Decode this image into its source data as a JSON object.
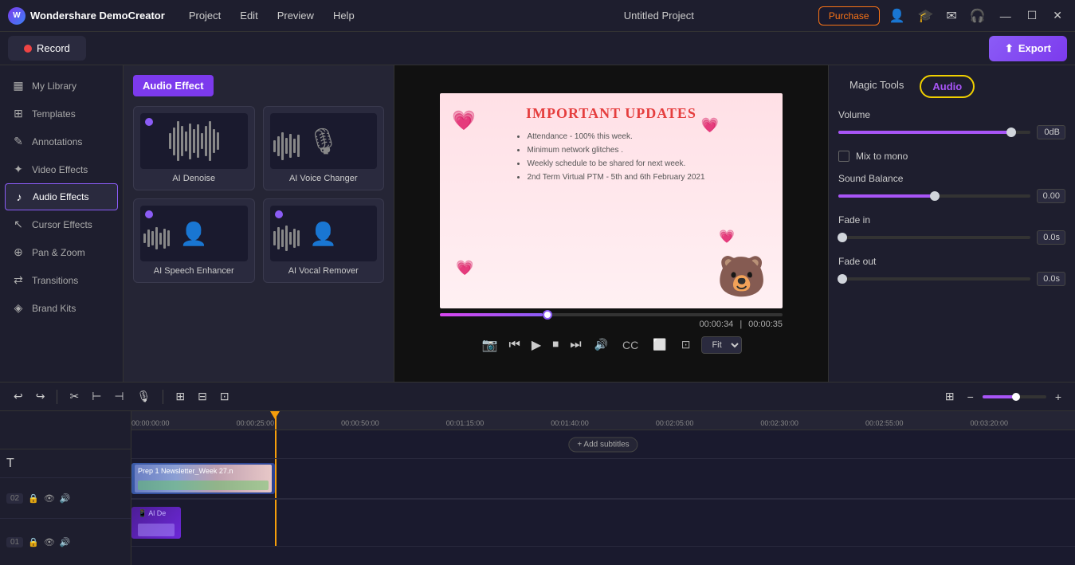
{
  "app": {
    "name": "Wondershare DemoCreator",
    "logo_icon": "W",
    "project_title": "Untitled Project"
  },
  "topbar": {
    "menu": [
      "Project",
      "Edit",
      "Preview",
      "Help"
    ],
    "purchase_label": "Purchase",
    "window_controls": [
      "—",
      "☐",
      "✕"
    ]
  },
  "recordbar": {
    "record_label": "Record",
    "export_label": "Export"
  },
  "sidebar": {
    "items": [
      {
        "id": "my-library",
        "label": "My Library",
        "icon": "▦"
      },
      {
        "id": "templates",
        "label": "Templates",
        "icon": "⊞"
      },
      {
        "id": "annotations",
        "label": "Annotations",
        "icon": "✎"
      },
      {
        "id": "video-effects",
        "label": "Video Effects",
        "icon": "✦"
      },
      {
        "id": "audio-effects",
        "label": "Audio Effects",
        "icon": "♪",
        "active": true
      },
      {
        "id": "cursor-effects",
        "label": "Cursor Effects",
        "icon": "↖"
      },
      {
        "id": "pan-zoom",
        "label": "Pan & Zoom",
        "icon": "⊕"
      },
      {
        "id": "transitions",
        "label": "Transitions",
        "icon": "⇄"
      },
      {
        "id": "brand-kits",
        "label": "Brand Kits",
        "icon": "◈"
      }
    ]
  },
  "audio_effects_panel": {
    "header": "Audio Effect",
    "effects": [
      {
        "id": "ai-denoise",
        "label": "AI Denoise",
        "has_purple_dot": true,
        "icon": "wave"
      },
      {
        "id": "ai-voice-changer",
        "label": "AI Voice Changer",
        "has_purple_dot": false,
        "icon": "mic"
      },
      {
        "id": "ai-speech-enhancer",
        "label": "AI Speech Enhancer",
        "has_purple_dot": true,
        "icon": "person"
      },
      {
        "id": "ai-vocal-remover",
        "label": "AI Vocal Remover",
        "has_purple_dot": true,
        "icon": "person2"
      }
    ]
  },
  "preview": {
    "title": "IMPORTANT UPDATES",
    "bullets": [
      "Attendance - 100% this week.",
      "Minimum network glitches .",
      "Weekly schedule to be shared for next week.",
      "2nd Term Virtual PTM - 5th and 6th February 2021"
    ],
    "time_current": "00:00:34",
    "time_total": "00:00:35",
    "fit_option": "Fit",
    "bear_emoji": "🐻",
    "heart_pink": "💗"
  },
  "right_panel": {
    "tab_magic_tools": "Magic Tools",
    "tab_audio": "Audio",
    "active_tab": "audio",
    "sections": {
      "volume": {
        "label": "Volume",
        "value": "0dB",
        "fill_pct": 90
      },
      "mix_to_mono": {
        "label": "Mix to mono",
        "checked": false
      },
      "sound_balance": {
        "label": "Sound Balance",
        "value": "0.00",
        "fill_pct": 50
      },
      "fade_in": {
        "label": "Fade in",
        "value": "0.0s",
        "fill_pct": 0
      },
      "fade_out": {
        "label": "Fade out",
        "value": "0.0s",
        "fill_pct": 0
      }
    }
  },
  "timeline": {
    "ruler_marks": [
      "00:00:00:00",
      "00:00:25:00",
      "00:00:50:00",
      "00:01:15:00",
      "00:01:40:00",
      "00:02:05:00",
      "00:02:30:00",
      "00:02:55:00",
      "00:03:20:00"
    ],
    "tools": [
      "↩",
      "↪",
      "|",
      "✂",
      "⊢",
      "⊣",
      "🎙",
      "|",
      "⊞",
      "⊟",
      "⊡"
    ],
    "tracks": [
      {
        "num": "02",
        "type": "video",
        "clip_label": "Prep 1 Newsletter_Week 27.n",
        "has_waveform": true
      },
      {
        "num": "01",
        "type": "audio",
        "clip_label": "Al De"
      }
    ],
    "add_subtitles_label": "+ Add subtitles"
  }
}
